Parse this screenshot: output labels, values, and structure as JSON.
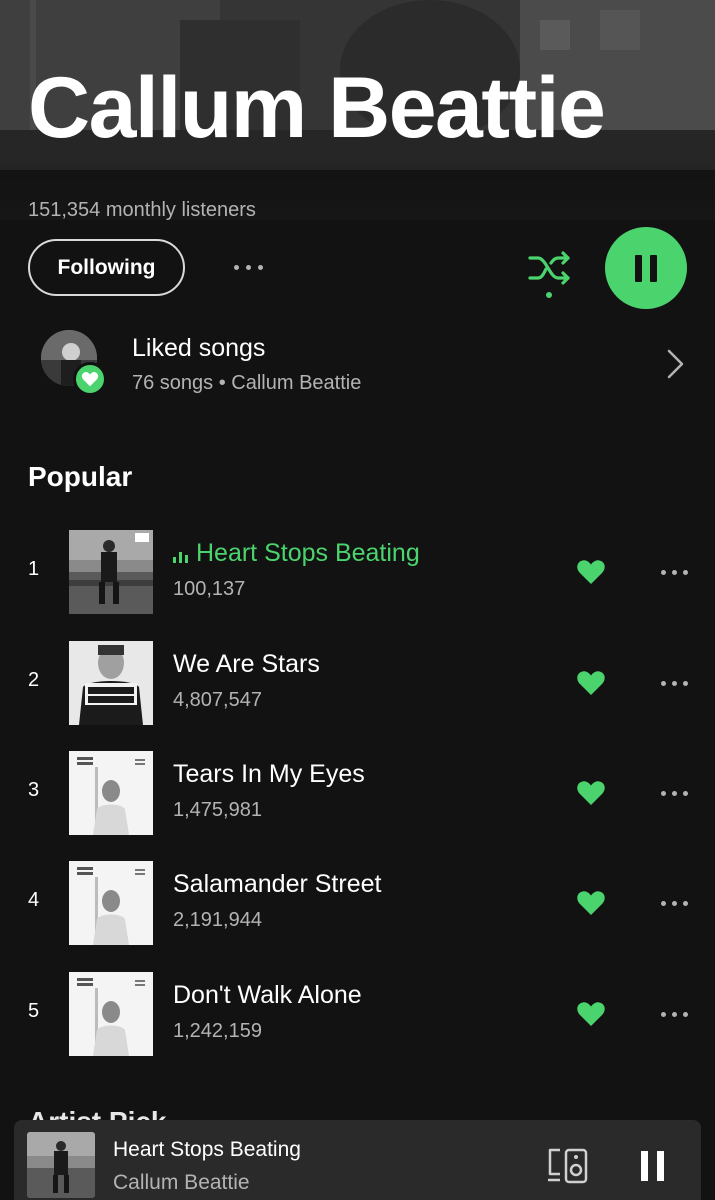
{
  "artist": {
    "name": "Callum Beattie",
    "monthly_listeners": "151,354 monthly listeners",
    "follow_label": "Following"
  },
  "liked_songs": {
    "title": "Liked songs",
    "subtitle": "76 songs • Callum Beattie"
  },
  "popular": {
    "title": "Popular",
    "tracks": [
      {
        "num": "1",
        "title": "Heart Stops Beating",
        "plays": "100,137",
        "playing": true
      },
      {
        "num": "2",
        "title": "We Are Stars",
        "plays": "4,807,547",
        "playing": false
      },
      {
        "num": "3",
        "title": "Tears In My Eyes",
        "plays": "1,475,981",
        "playing": false
      },
      {
        "num": "4",
        "title": "Salamander Street",
        "plays": "2,191,944",
        "playing": false
      },
      {
        "num": "5",
        "title": "Don't Walk Alone",
        "plays": "1,242,159",
        "playing": false
      }
    ]
  },
  "next_section_title": "Artist Pick",
  "now_playing": {
    "title": "Heart Stops Beating",
    "artist": "Callum Beattie"
  },
  "colors": {
    "accent": "#4bd46e",
    "background": "#121212",
    "secondary_text": "#b3b3b3",
    "mini_player": "#2a2a2a"
  },
  "icons": {
    "more": "more-dots-icon",
    "shuffle": "shuffle-icon",
    "play_pause": "pause-icon",
    "liked_heart": "heart-icon",
    "chevron": "chevron-right-icon",
    "device": "connect-device-icon"
  }
}
